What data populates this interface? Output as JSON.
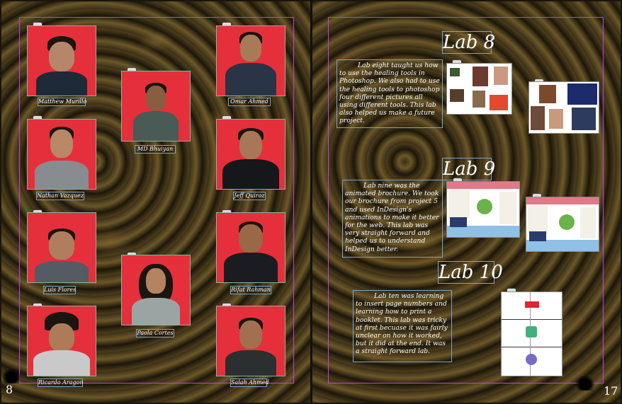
{
  "left_page": {
    "page_number": "8",
    "students": [
      {
        "name": "Matthew Murillo"
      },
      {
        "name": "MD Bhuiyan"
      },
      {
        "name": "Omar Ahmed"
      },
      {
        "name": "Nathan Vazquez"
      },
      {
        "name": "Jeff Quiroz"
      },
      {
        "name": "Luis Flores"
      },
      {
        "name": "Rifat Rahman"
      },
      {
        "name": "Paola Cortes"
      },
      {
        "name": "Ricardo Aragon"
      },
      {
        "name": "Salah Ahmed"
      }
    ]
  },
  "right_page": {
    "page_number": "17",
    "labs": [
      {
        "title": "Lab 8",
        "text": "Lab eight taught us how to use the healing tools in Photoshop. We also had to use the healing tools to photoshop four different pictures all using different tools. This lab also helped us make a future project."
      },
      {
        "title": "Lab 9",
        "text": "Lab nine was the animated brochure. We took our brochure from project 5 and used InDesign's animations to make it better for the web. This lab was very straight forward and helped us to understand InDesign better."
      },
      {
        "title": "Lab 10",
        "text": "Lab ten was learning to insert page numbers and learning how to print a booklet. This lab was tricky at first becuase it was fairly unclear on how it worked, but it did at the end. It was a straight forward lab."
      }
    ]
  },
  "colors": {
    "photo_background": "#e5303b",
    "frame_guide": "#c040e0",
    "caption_border": "#7aa6c8"
  }
}
